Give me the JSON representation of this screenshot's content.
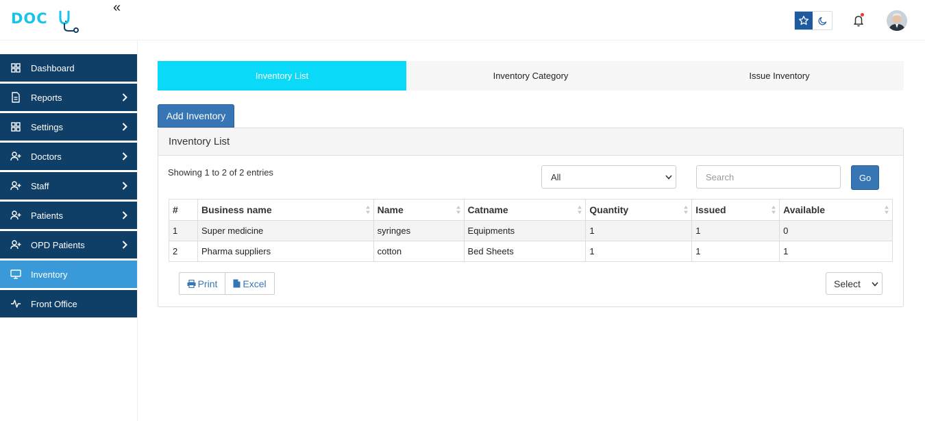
{
  "brand": {
    "logo_text": "DOC",
    "accent": "#17c3e8",
    "navy": "#0f3e66"
  },
  "topbar": {
    "collapse_glyph": "«",
    "icons": [
      "star-icon",
      "moon-icon",
      "bell-icon",
      "avatar"
    ]
  },
  "sidebar": {
    "items": [
      {
        "label": "Dashboard",
        "icon": "dashboard-grid-icon",
        "has_submenu": false,
        "active": false
      },
      {
        "label": "Reports",
        "icon": "document-icon",
        "has_submenu": true,
        "active": false
      },
      {
        "label": "Settings",
        "icon": "settings-grid-icon",
        "has_submenu": true,
        "active": false
      },
      {
        "label": "Doctors",
        "icon": "user-plus-icon",
        "has_submenu": true,
        "active": false
      },
      {
        "label": "Staff",
        "icon": "user-plus-icon",
        "has_submenu": true,
        "active": false
      },
      {
        "label": "Patients",
        "icon": "user-plus-icon",
        "has_submenu": true,
        "active": false
      },
      {
        "label": "OPD Patients",
        "icon": "user-plus-icon",
        "has_submenu": true,
        "active": false
      },
      {
        "label": "Inventory",
        "icon": "monitor-icon",
        "has_submenu": false,
        "active": true
      },
      {
        "label": "Front Office",
        "icon": "activity-icon",
        "has_submenu": false,
        "active": false
      }
    ]
  },
  "tabs": [
    {
      "label": "Inventory List",
      "active": true
    },
    {
      "label": "Inventory Category",
      "active": false
    },
    {
      "label": "Issue Inventory",
      "active": false
    }
  ],
  "add_button": "Add Inventory",
  "panel": {
    "title": "Inventory List",
    "showing": "Showing 1 to 2 of 2 entries",
    "filter_selected": "All",
    "search_placeholder": "Search",
    "go_label": "Go",
    "columns": [
      "#",
      "Business name",
      "Name",
      "Catname",
      "Quantity",
      "Issued",
      "Available"
    ],
    "rows": [
      [
        "1",
        "Super medicine",
        "syringes",
        "Equipments",
        "1",
        "1",
        "0"
      ],
      [
        "2",
        "Pharma suppliers",
        "cotton",
        "Bed Sheets",
        "1",
        "1",
        "1"
      ]
    ],
    "print_label": "Print",
    "excel_label": "Excel",
    "page_select": "Select"
  }
}
